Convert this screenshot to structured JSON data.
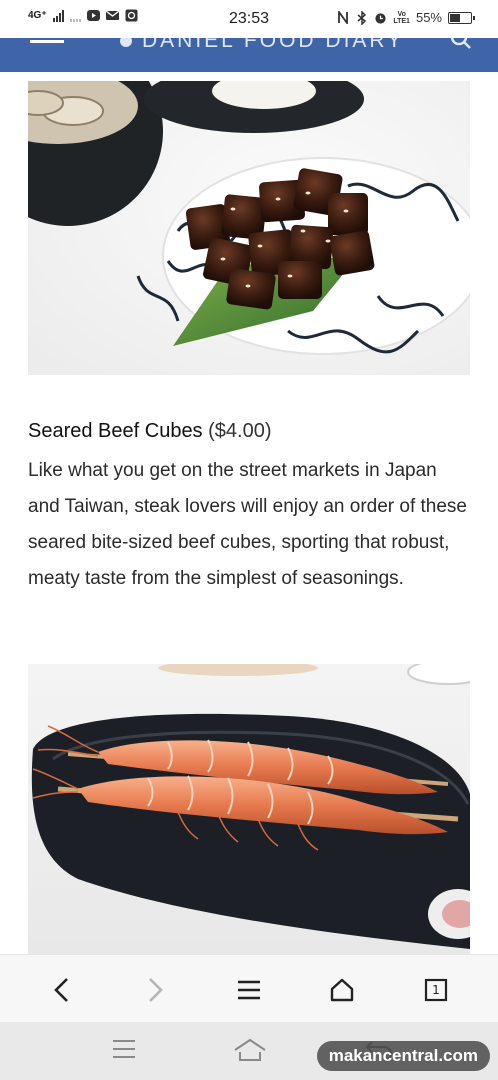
{
  "status_bar": {
    "network": "4G⁺",
    "time": "23:53",
    "volte": "VoLTE1",
    "battery_percent": "55%",
    "battery_level": 0.55,
    "icons": [
      "youtube-icon",
      "mail-icon",
      "gallery-icon",
      "nfc-icon",
      "bluetooth-icon",
      "alarm-icon"
    ]
  },
  "header": {
    "site_title": "DANIEL FOOD DIARY",
    "bg_color": "#3f65a8"
  },
  "article": {
    "dish": {
      "name": "Seared Beef Cubes",
      "price": "($4.00)",
      "description": "Like what you get on the street markets in Japan and Taiwan, steak lovers will enjoy an order of these seared bite-sized beef cubes, sporting that robust, meaty taste from the simplest of seasonings."
    }
  },
  "browser_toolbar": {
    "icons": [
      "back-icon",
      "forward-icon",
      "menu-icon",
      "home-icon",
      "tabs-icon"
    ],
    "tab_count": "1"
  },
  "system_nav": {
    "icons": [
      "recents-icon",
      "home-icon",
      "back-icon"
    ]
  },
  "watermark": "makancentral.com"
}
